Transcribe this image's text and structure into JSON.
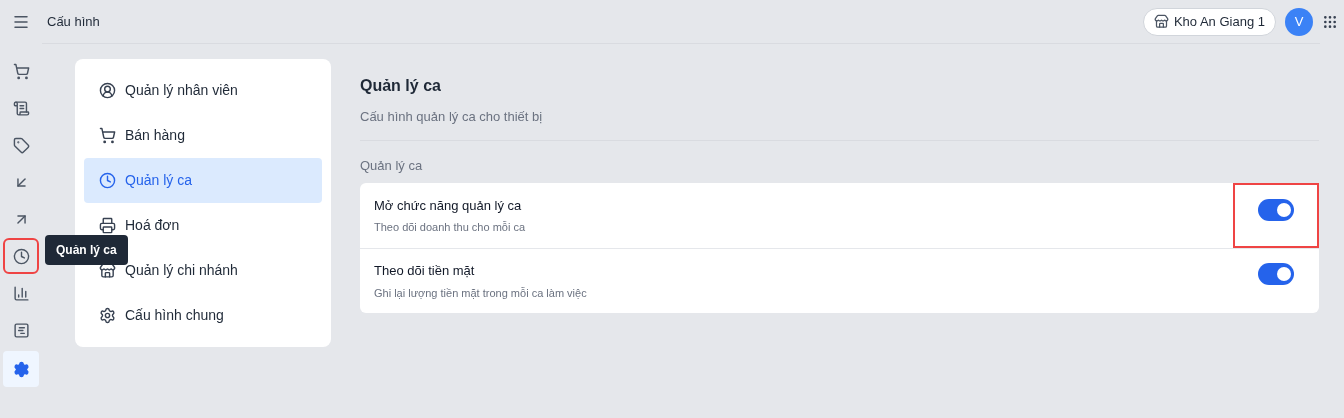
{
  "header": {
    "title": "Cấu hình",
    "store": "Kho An Giang 1",
    "avatar": "V"
  },
  "rail": [
    {
      "selected": false,
      "highlighted": false
    },
    {
      "selected": false,
      "highlighted": false
    },
    {
      "selected": false,
      "highlighted": false
    },
    {
      "selected": false,
      "highlighted": false
    },
    {
      "selected": false,
      "highlighted": false
    },
    {
      "selected": false,
      "highlighted": true
    },
    {
      "selected": false,
      "highlighted": false
    },
    {
      "selected": false,
      "highlighted": false
    },
    {
      "selected": true,
      "highlighted": false
    }
  ],
  "tooltip": "Quản lý ca",
  "menu": [
    {
      "label": "Quản lý nhân viên",
      "selected": false
    },
    {
      "label": "Bán hàng",
      "selected": false
    },
    {
      "label": "Quản lý ca",
      "selected": true
    },
    {
      "label": "Hoá đơn",
      "selected": false
    },
    {
      "label": "Quản lý chi nhánh",
      "selected": false
    },
    {
      "label": "Cấu hình chung",
      "selected": false
    }
  ],
  "section": {
    "title": "Quản lý ca",
    "subtitle": "Cấu hình quản lý ca cho thiết bị",
    "group": "Quản lý ca",
    "settings": [
      {
        "label": "Mở chức năng quản lý ca",
        "hint": "Theo dõi doanh thu cho mỗi ca",
        "on": true,
        "highlighted": true
      },
      {
        "label": "Theo dõi tiền mặt",
        "hint": "Ghi lại lượng tiền mặt trong mỗi ca làm việc",
        "on": true,
        "highlighted": false
      }
    ]
  }
}
